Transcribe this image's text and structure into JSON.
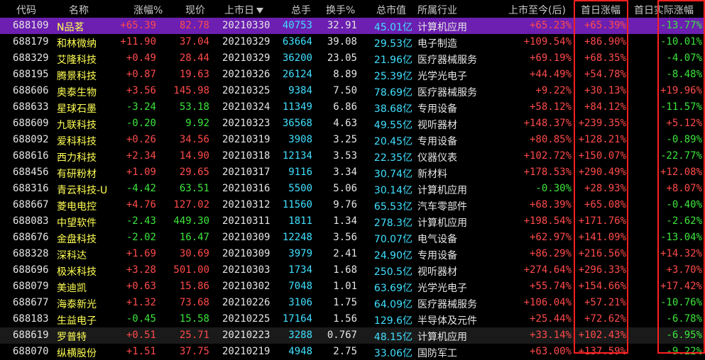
{
  "columns": {
    "code": "代码",
    "name": "名称",
    "change": "涨幅%",
    "price": "现价",
    "list_date": "上市日",
    "volume": "总手",
    "turnover": "换手%",
    "market_cap": "总市值",
    "industry": "所属行业",
    "since_listing": "上市至今(后)",
    "first_day_rise": "首日涨幅",
    "first_day_actual": "首日实际涨幅"
  },
  "rows": [
    {
      "code": "688109",
      "name": "N品茗",
      "change": "+65.39",
      "price": "82.78",
      "date": "20210330",
      "vol": "40753",
      "turn": "32.91",
      "cap": "45.01亿",
      "ind": "计算机应用",
      "since": "+65.23%",
      "first": "+65.39%",
      "actual": "-13.77%",
      "dir": "up",
      "adir": "down",
      "sel": true
    },
    {
      "code": "688179",
      "name": "和林微纳",
      "change": "+11.90",
      "price": "37.04",
      "date": "20210329",
      "vol": "63664",
      "turn": "39.08",
      "cap": "29.53亿",
      "ind": "电子制造",
      "since": "+109.54%",
      "first": "+86.90%",
      "actual": "-10.01%",
      "dir": "up",
      "adir": "down"
    },
    {
      "code": "688329",
      "name": "艾隆科技",
      "change": "+0.49",
      "price": "28.44",
      "date": "20210329",
      "vol": "36200",
      "turn": "23.05",
      "cap": "21.96亿",
      "ind": "医疗器械服务",
      "since": "+69.19%",
      "first": "+68.35%",
      "actual": "-4.07%",
      "dir": "up",
      "adir": "down"
    },
    {
      "code": "688195",
      "name": "腾景科技",
      "change": "+0.87",
      "price": "19.63",
      "date": "20210326",
      "vol": "26124",
      "turn": "8.89",
      "cap": "25.39亿",
      "ind": "光学光电子",
      "since": "+44.49%",
      "first": "+54.78%",
      "actual": "-8.48%",
      "dir": "up",
      "adir": "down"
    },
    {
      "code": "688606",
      "name": "奥泰生物",
      "change": "+3.56",
      "price": "145.98",
      "date": "20210325",
      "vol": "9384",
      "turn": "7.50",
      "cap": "78.69亿",
      "ind": "医疗器械服务",
      "since": "+9.22%",
      "first": "+30.13%",
      "actual": "+19.96%",
      "dir": "up",
      "adir": "up"
    },
    {
      "code": "688633",
      "name": "星球石墨",
      "change": "-3.24",
      "price": "53.18",
      "date": "20210324",
      "vol": "11349",
      "turn": "6.86",
      "cap": "38.68亿",
      "ind": "专用设备",
      "since": "+58.12%",
      "first": "+84.12%",
      "actual": "-11.57%",
      "dir": "down",
      "adir": "down"
    },
    {
      "code": "688609",
      "name": "九联科技",
      "change": "-0.20",
      "price": "9.92",
      "date": "20210323",
      "vol": "36568",
      "turn": "4.63",
      "cap": "49.55亿",
      "ind": "视听器材",
      "since": "+148.37%",
      "first": "+239.35%",
      "actual": "+5.12%",
      "dir": "down",
      "adir": "up"
    },
    {
      "code": "688092",
      "name": "爱科科技",
      "change": "+0.26",
      "price": "34.56",
      "date": "20210319",
      "vol": "3908",
      "turn": "3.25",
      "cap": "20.45亿",
      "ind": "专用设备",
      "since": "+80.85%",
      "first": "+128.21%",
      "actual": "-0.89%",
      "dir": "up",
      "adir": "down"
    },
    {
      "code": "688616",
      "name": "西力科技",
      "change": "+2.34",
      "price": "14.90",
      "date": "20210318",
      "vol": "12134",
      "turn": "3.53",
      "cap": "22.35亿",
      "ind": "仪器仪表",
      "since": "+102.72%",
      "first": "+150.07%",
      "actual": "-22.77%",
      "dir": "up",
      "adir": "down"
    },
    {
      "code": "688456",
      "name": "有研粉材",
      "change": "+1.09",
      "price": "29.65",
      "date": "20210317",
      "vol": "9116",
      "turn": "3.34",
      "cap": "30.74亿",
      "ind": "新材料",
      "since": "+178.53%",
      "first": "+290.49%",
      "actual": "+12.08%",
      "dir": "up",
      "adir": "up"
    },
    {
      "code": "688316",
      "name": "青云科技-U",
      "change": "-4.42",
      "price": "63.51",
      "date": "20210316",
      "vol": "5500",
      "turn": "5.06",
      "cap": "30.14亿",
      "ind": "计算机应用",
      "since": "-0.30%",
      "first": "+28.93%",
      "actual": "+8.07%",
      "dir": "down",
      "adir": "up",
      "sdir": "down"
    },
    {
      "code": "688667",
      "name": "菱电电控",
      "change": "+4.76",
      "price": "127.02",
      "date": "20210312",
      "vol": "11560",
      "turn": "9.76",
      "cap": "65.53亿",
      "ind": "汽车零部件",
      "since": "+68.39%",
      "first": "+65.08%",
      "actual": "-0.40%",
      "dir": "up",
      "adir": "down"
    },
    {
      "code": "688083",
      "name": "中望软件",
      "change": "-2.43",
      "price": "449.30",
      "date": "20210311",
      "vol": "1811",
      "turn": "1.34",
      "cap": "278.3亿",
      "ind": "计算机应用",
      "since": "+198.54%",
      "first": "+171.76%",
      "actual": "-2.62%",
      "dir": "down",
      "adir": "down"
    },
    {
      "code": "688676",
      "name": "金盘科技",
      "change": "-2.02",
      "price": "16.47",
      "date": "20210309",
      "vol": "12248",
      "turn": "3.56",
      "cap": "70.07亿",
      "ind": "电气设备",
      "since": "+62.97%",
      "first": "+141.09%",
      "actual": "-13.04%",
      "dir": "down",
      "adir": "down"
    },
    {
      "code": "688328",
      "name": "深科达",
      "change": "+1.69",
      "price": "30.69",
      "date": "20210309",
      "vol": "3979",
      "turn": "2.41",
      "cap": "24.90亿",
      "ind": "专用设备",
      "since": "+86.29%",
      "first": "+216.56%",
      "actual": "+14.32%",
      "dir": "up",
      "adir": "up"
    },
    {
      "code": "688696",
      "name": "极米科技",
      "change": "+3.28",
      "price": "501.00",
      "date": "20210303",
      "vol": "1734",
      "turn": "1.68",
      "cap": "250.5亿",
      "ind": "视听器材",
      "since": "+274.64%",
      "first": "+296.33%",
      "actual": "+3.70%",
      "dir": "up",
      "adir": "up"
    },
    {
      "code": "688079",
      "name": "美迪凯",
      "change": "+0.63",
      "price": "15.86",
      "date": "20210302",
      "vol": "7048",
      "turn": "1.01",
      "cap": "63.69亿",
      "ind": "光学光电子",
      "since": "+55.74%",
      "first": "+154.66%",
      "actual": "+17.42%",
      "dir": "up",
      "adir": "up"
    },
    {
      "code": "688677",
      "name": "海泰新光",
      "change": "+1.32",
      "price": "73.68",
      "date": "20210226",
      "vol": "3106",
      "turn": "1.75",
      "cap": "64.09亿",
      "ind": "医疗器械服务",
      "since": "+106.04%",
      "first": "+57.21%",
      "actual": "-10.76%",
      "dir": "up",
      "adir": "down"
    },
    {
      "code": "688183",
      "name": "生益电子",
      "change": "-0.45",
      "price": "15.58",
      "date": "20210225",
      "vol": "17164",
      "turn": "1.56",
      "cap": "129.6亿",
      "ind": "半导体及元件",
      "since": "+25.44%",
      "first": "+72.62%",
      "actual": "-6.78%",
      "dir": "down",
      "adir": "down"
    },
    {
      "code": "688619",
      "name": "罗普特",
      "change": "+0.51",
      "price": "25.71",
      "date": "20210223",
      "vol": "3288",
      "turn": "0.767",
      "cap": "48.15亿",
      "ind": "计算机应用",
      "since": "+33.14%",
      "first": "+102.43%",
      "actual": "-6.95%",
      "dir": "up",
      "adir": "down",
      "hl": true
    },
    {
      "code": "688070",
      "name": "纵横股份",
      "change": "+1.51",
      "price": "37.75",
      "date": "20210219",
      "vol": "4948",
      "turn": "2.75",
      "cap": "33.06亿",
      "ind": "国防军工",
      "since": "+63.00%",
      "first": "+137.59%",
      "actual": "-9.22%",
      "dir": "up",
      "adir": "down"
    }
  ]
}
